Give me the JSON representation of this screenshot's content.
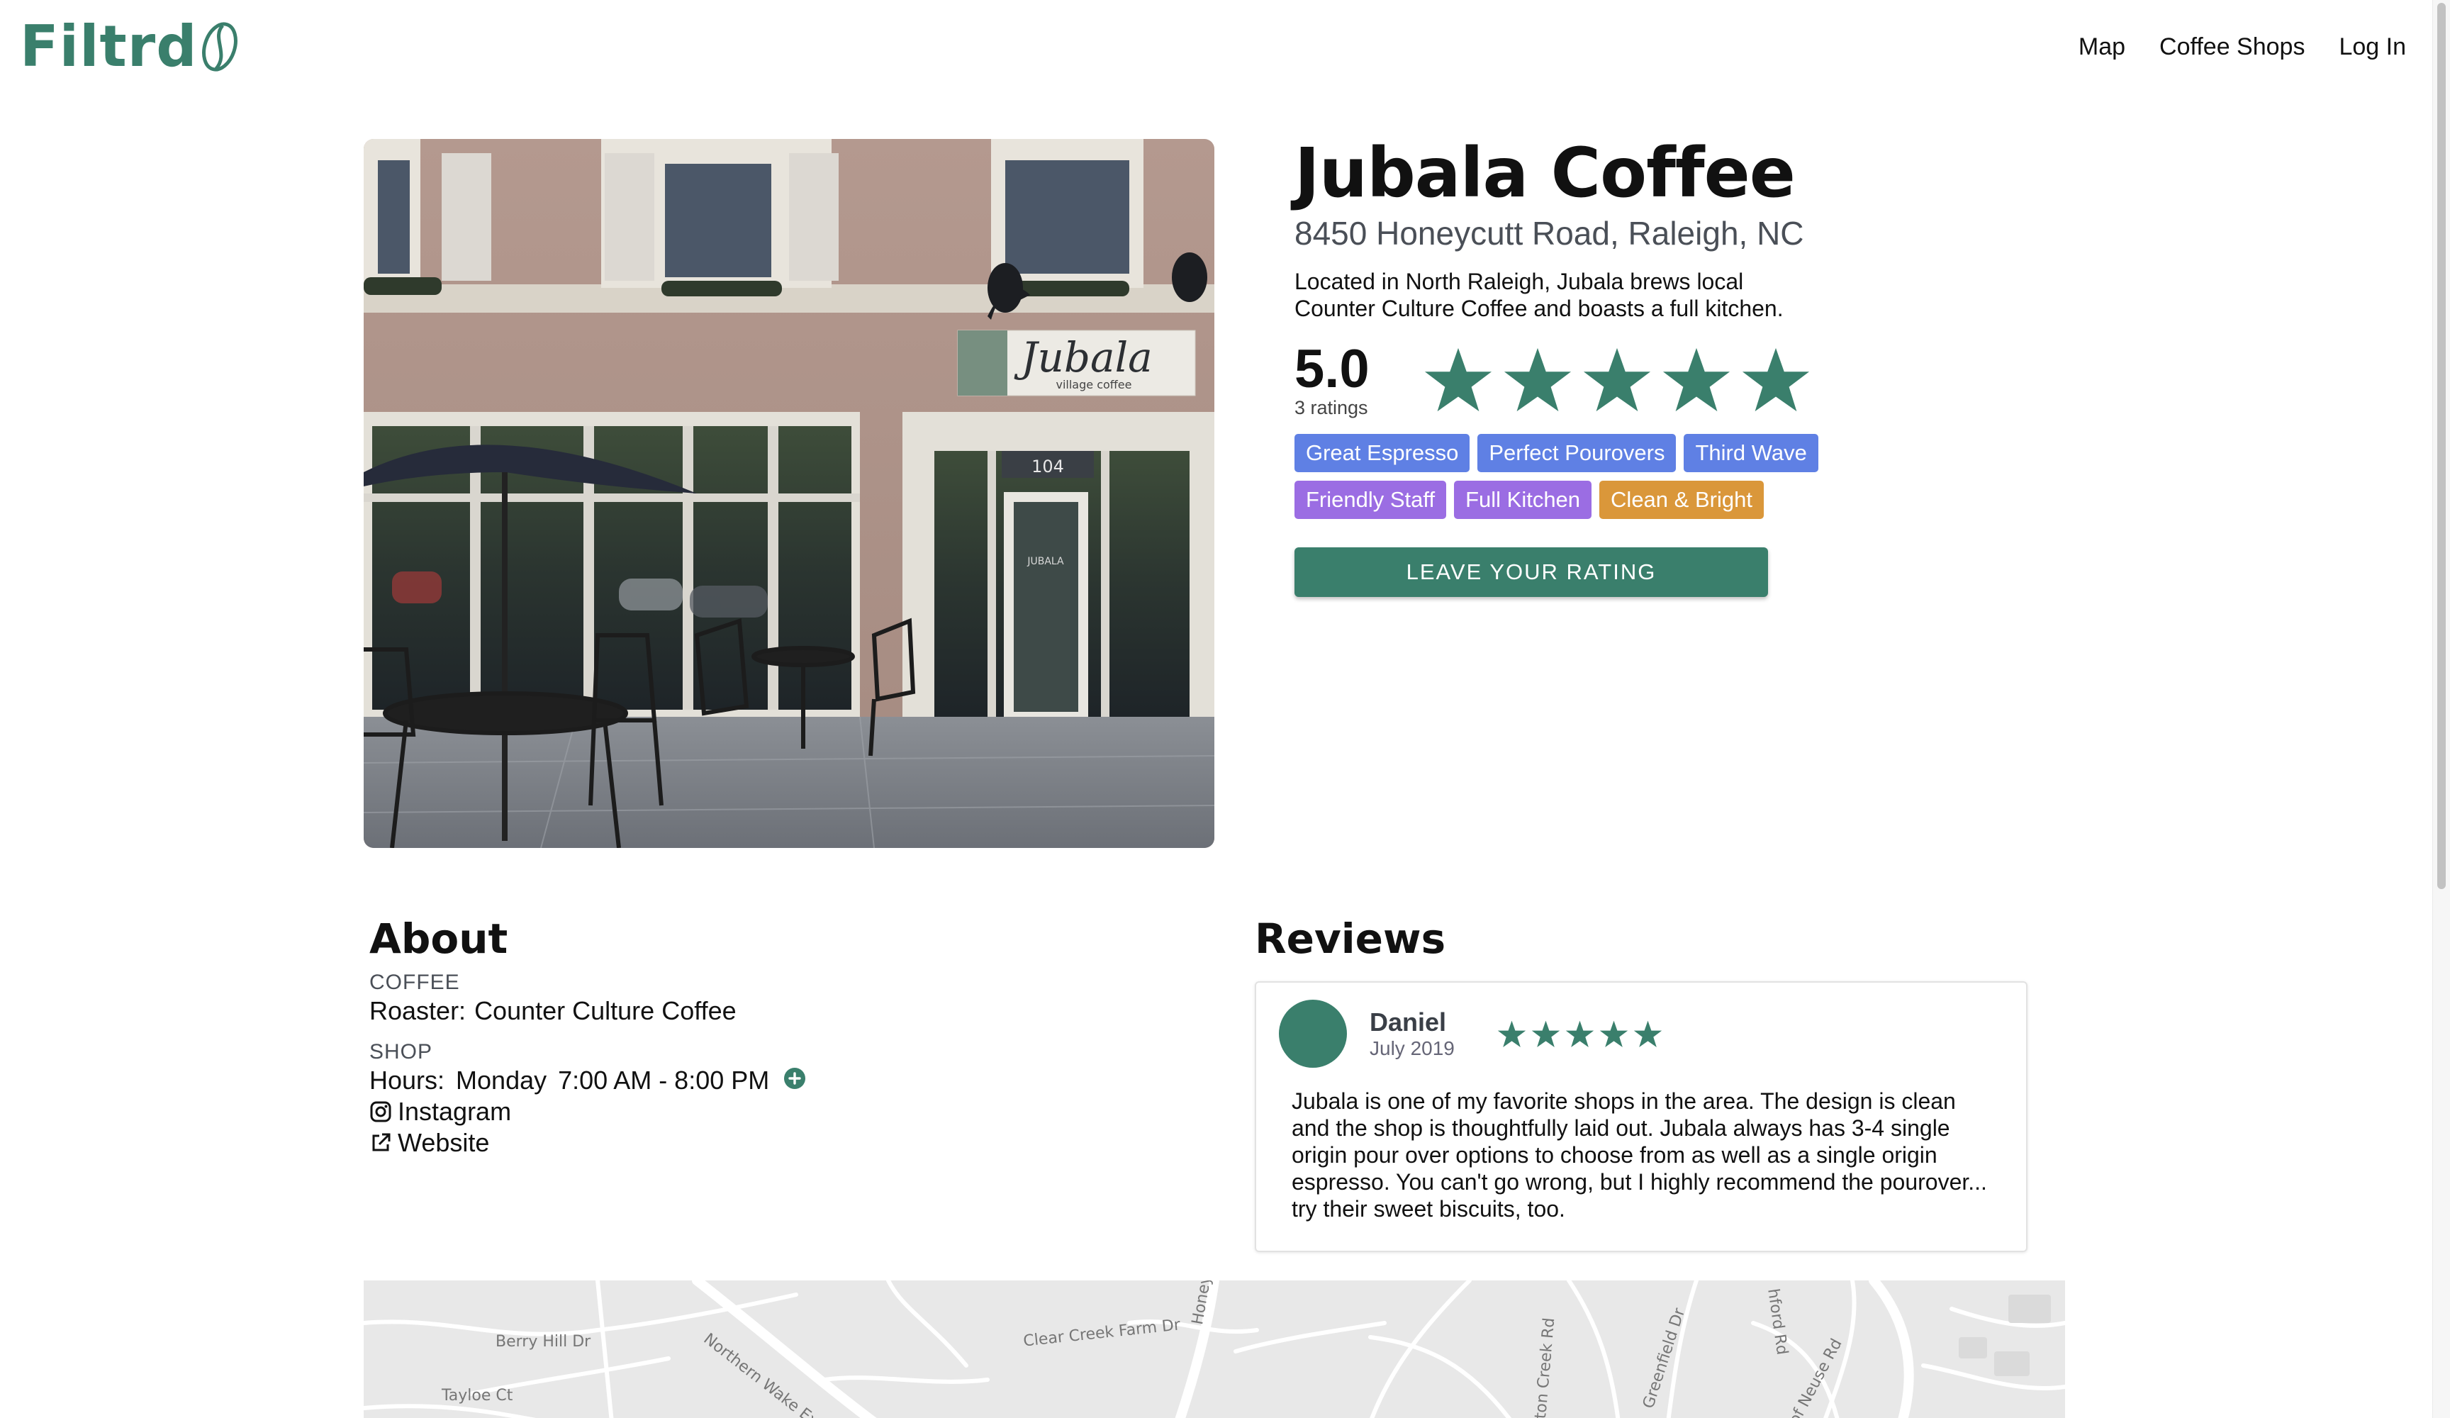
{
  "header": {
    "brand": "Filtrd",
    "nav": [
      {
        "label": "Map"
      },
      {
        "label": "Coffee Shops"
      },
      {
        "label": "Log In"
      }
    ]
  },
  "shop": {
    "name": "Jubala Coffee",
    "address": "8450 Honeycutt Road, Raleigh, NC",
    "description": "Located in North Raleigh, Jubala brews local Counter Culture Coffee and boasts a full kitchen.",
    "rating": "5.0",
    "rating_count": "3 ratings",
    "star_rating": 5,
    "storefront_sign": "Jubala",
    "storefront_sign_sub": "village coffee",
    "door_number": "104",
    "door_sign": "JUBALA",
    "tags": [
      {
        "label": "Great Espresso",
        "color": "#5f80e4"
      },
      {
        "label": "Perfect Pourovers",
        "color": "#5f80e4"
      },
      {
        "label": "Third Wave",
        "color": "#5f80e4"
      },
      {
        "label": "Friendly Staff",
        "color": "#9b6de3"
      },
      {
        "label": "Full Kitchen",
        "color": "#9b6de3"
      },
      {
        "label": "Clean & Bright",
        "color": "#da973a"
      }
    ],
    "rate_button": "LEAVE YOUR RATING"
  },
  "about": {
    "title": "About",
    "coffee_label": "COFFEE",
    "roaster_label": "Roaster:",
    "roaster_value": "Counter Culture Coffee",
    "shop_label": "SHOP",
    "hours_label": "Hours:",
    "hours_day": "Monday",
    "hours_time": "7:00 AM - 8:00 PM",
    "instagram": "Instagram",
    "website": "Website"
  },
  "reviews": {
    "title": "Reviews",
    "items": [
      {
        "name": "Daniel",
        "date": "July 2019",
        "stars": 5,
        "text": "Jubala is one of my favorite shops in the area. The design is clean and the shop is thoughtfully laid out. Jubala always has 3-4 single origin pour over options to choose from as well as a single origin espresso. You can't go wrong, but I highly recommend the pourover... try their sweet biscuits, too."
      }
    ]
  },
  "map": {
    "labels": [
      "Berry Hill Dr",
      "Tayloe Ct",
      "Northern Wake Expy",
      "Clear Creek Farm Dr",
      "Honeycutt",
      "ton Creek Rd",
      "Greenfield Dr",
      "hford Rd",
      "of Neuse Rd"
    ]
  },
  "colors": {
    "brand": "#3a7f6c",
    "tag_blue": "#5f80e4",
    "tag_purple": "#9b6de3",
    "tag_orange": "#da973a"
  }
}
